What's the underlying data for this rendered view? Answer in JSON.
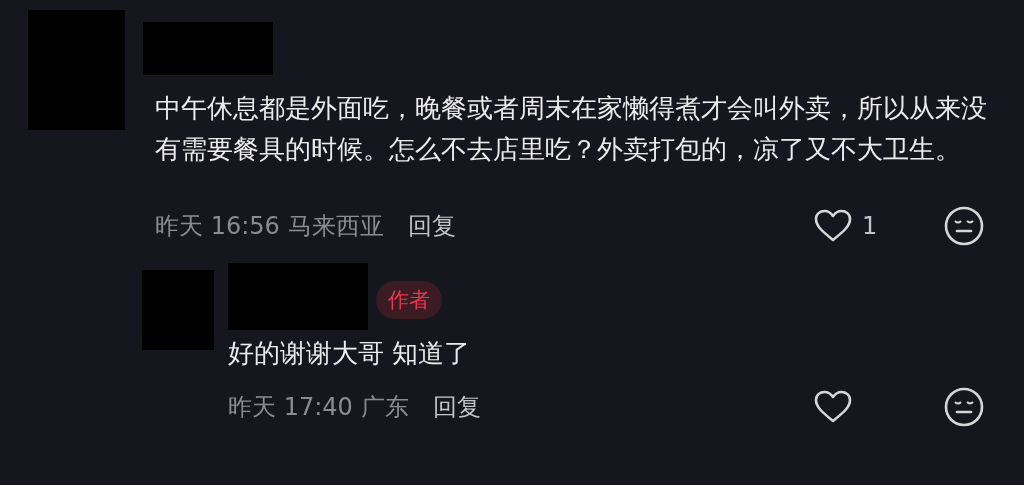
{
  "comments": [
    {
      "text": "中午休息都是外面吃，晚餐或者周末在家懒得煮才会叫外卖，所以从来没有需要餐具的时候。怎么不去店里吃？外卖打包的，凉了又不大卫生。",
      "time": "昨天 16:56",
      "location": "马来西亚",
      "reply_label": "回复",
      "like_count": "1",
      "liked": false,
      "replies": [
        {
          "badge": "作者",
          "text": "好的谢谢大哥 知道了",
          "time": "昨天 17:40",
          "location": "广东",
          "reply_label": "回复",
          "liked": false
        }
      ]
    }
  ]
}
